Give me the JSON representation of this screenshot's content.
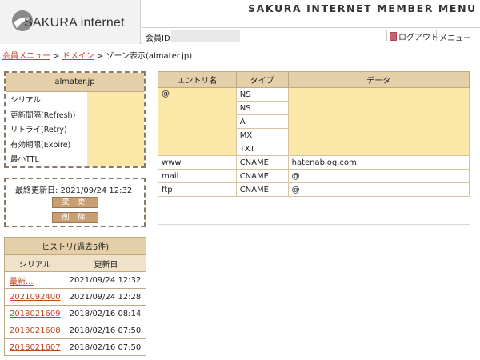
{
  "header": {
    "logo_text": "SAKURA internet",
    "title": "SAKURA INTERNET MEMBER MENU",
    "member_id_label": "会員ID:",
    "logout_label": "ログアウト",
    "menu_label": "メニュー"
  },
  "breadcrumb": {
    "items": [
      "会員メニュー",
      "ドメイン"
    ],
    "separator": " > ",
    "current": "ゾーン表示(almater.jp)"
  },
  "zone": {
    "domain": "almater.jp",
    "fields": [
      "シリアル",
      "更新間隔(Refresh)",
      "リトライ(Retry)",
      "有効期限(Expire)",
      "最小TTL"
    ]
  },
  "update": {
    "last_updated": "最終更新日: 2021/09/24 12:32",
    "change_label": "変 更",
    "delete_label": "削 除"
  },
  "history": {
    "title": "ヒストリ(過去5件)",
    "columns": [
      "シリアル",
      "更新日"
    ],
    "rows": [
      {
        "serial": "最新...",
        "date": "2021/09/24 12:32"
      },
      {
        "serial": "2021092400",
        "date": "2021/09/24 12:28"
      },
      {
        "serial": "2018021609",
        "date": "2018/02/16 08:14"
      },
      {
        "serial": "2018021608",
        "date": "2018/02/16 07:50"
      },
      {
        "serial": "2018021607",
        "date": "2018/02/16 07:50"
      }
    ]
  },
  "dns": {
    "columns": [
      "エントリ名",
      "タイプ",
      "データ"
    ],
    "at_entry": "@",
    "at_types": [
      "NS",
      "NS",
      "A",
      "MX",
      "TXT"
    ],
    "records": [
      {
        "entry": "www",
        "type": "CNAME",
        "data": "hatenablog.com."
      },
      {
        "entry": "mail",
        "type": "CNAME",
        "data": "@"
      },
      {
        "entry": "ftp",
        "type": "CNAME",
        "data": "@"
      }
    ]
  },
  "colors": {
    "accent": "#e5cfa9",
    "highlight": "#fbe7a7",
    "link": "#c0471e",
    "button": "#c89f73"
  }
}
